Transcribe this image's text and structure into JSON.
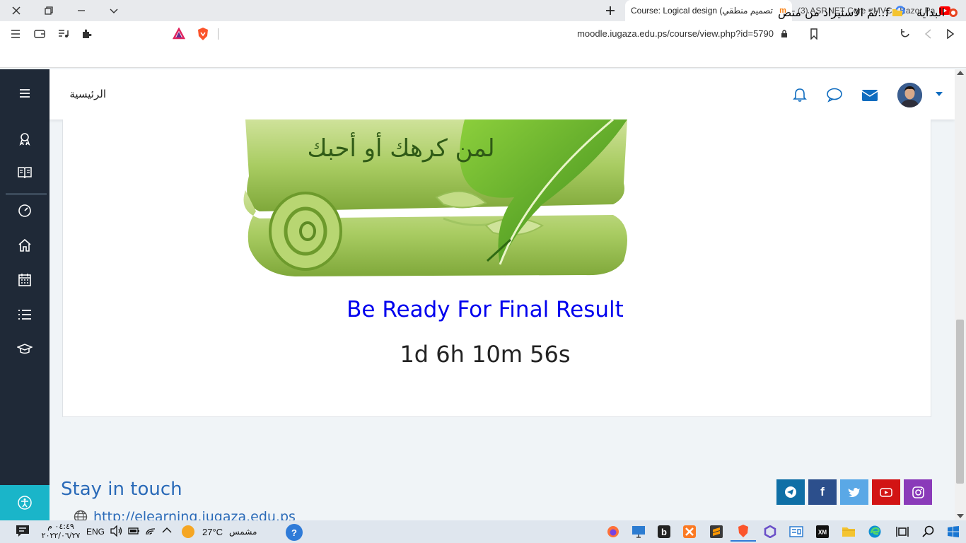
{
  "browser": {
    "tabs": [
      {
        "title": "Course: Logical design (تصميم منطقي",
        "active": true
      },
      {
        "title": "(3) ASP.NET Core - MVC - Razor Pages",
        "active": false
      }
    ],
    "url": "moodle.iugaza.edu.ps/course/view.php?id=5790",
    "bookmarks": [
      {
        "label": "البداية",
        "icon": "brave-icon"
      },
      {
        "label": "",
        "icon": "google-icon"
      },
      {
        "label": "f",
        "icon": "facebook-icon"
      },
      {
        "label": "تمّ الاستيراد من متص...",
        "icon": "folder-icon"
      }
    ]
  },
  "navbar": {
    "home_label": "الرئيسية"
  },
  "content": {
    "image_text": "لمن كرهك أو أحبك",
    "result_title": "Be Ready For Final Result",
    "countdown": "1d 6h 10m 56s"
  },
  "footer": {
    "stay_title": "Stay in touch",
    "link": "http://elearning.iugaza.edu.ps",
    "social": [
      {
        "name": "telegram",
        "color": "#0f6fa6"
      },
      {
        "name": "facebook",
        "color": "#2c4f8c"
      },
      {
        "name": "twitter",
        "color": "#5aa8e6"
      },
      {
        "name": "youtube",
        "color": "#d21414"
      },
      {
        "name": "instagram",
        "color": "#8a3ab9"
      }
    ]
  },
  "taskbar": {
    "time": "٠٤:٤٩ م",
    "date": "٢٠٢٢/٠٦/٢٧",
    "lang": "ENG",
    "temperature": "27°C",
    "weather": "مشمس"
  },
  "colors": {
    "sidebar": "#1f2937",
    "accent": "#0f6cbf",
    "title_blue": "#0000ee"
  }
}
